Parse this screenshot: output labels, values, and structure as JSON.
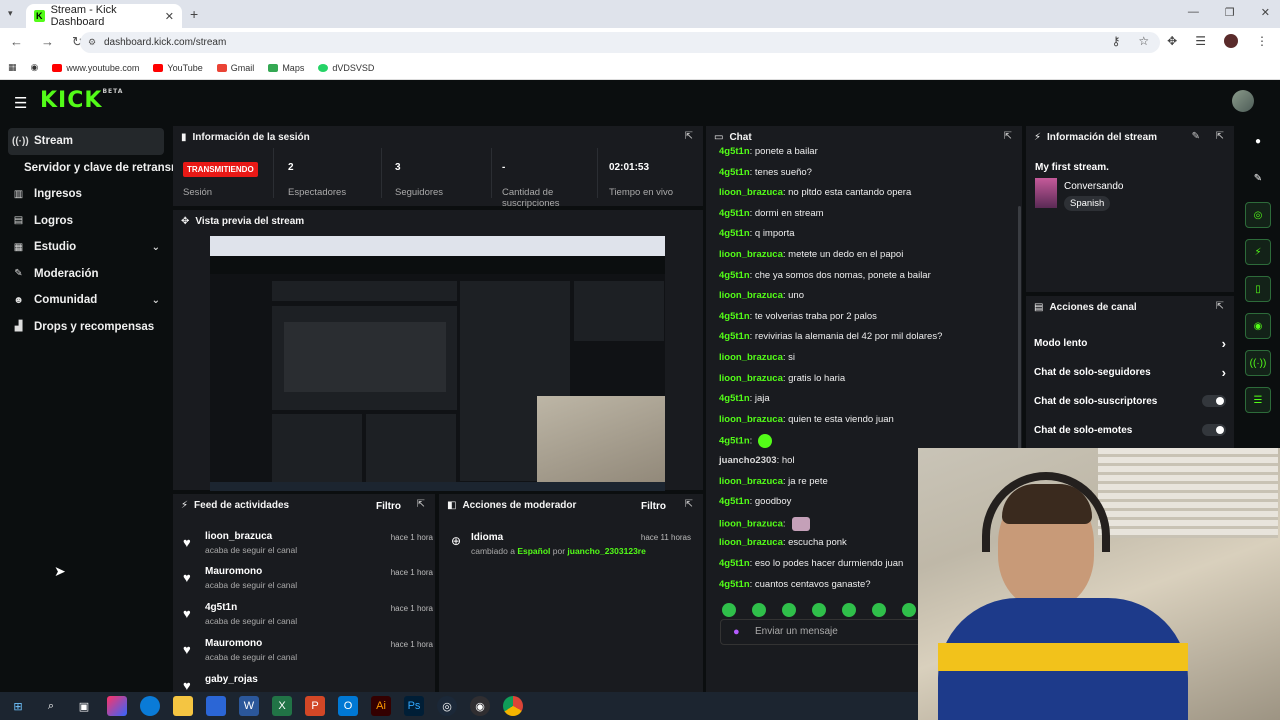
{
  "browser": {
    "tab_title": "Stream - Kick Dashboard",
    "tab_close": "✕",
    "new_tab": "+",
    "url": "dashboard.kick.com/stream",
    "bookmarks": [
      {
        "label": "www.youtube.com",
        "color": "#ff0000"
      },
      {
        "label": "YouTube",
        "color": "#ff0000"
      },
      {
        "label": "Gmail",
        "color": "#ea4335"
      },
      {
        "label": "Maps",
        "color": "#34a853"
      },
      {
        "label": "dVDSVSD",
        "color": "#25d366"
      }
    ]
  },
  "app": {
    "logo": "KICK",
    "logo_sup": "BETA",
    "accent": "#53fc18"
  },
  "sidebar": {
    "items": [
      {
        "label": "Stream",
        "icon": "broadcast-icon",
        "glyph": "((·))",
        "active": true
      },
      {
        "label": "Servidor y clave de retransm",
        "sub": true
      },
      {
        "label": "Ingresos",
        "icon": "chart-icon",
        "glyph": "▥"
      },
      {
        "label": "Logros",
        "icon": "book-icon",
        "glyph": "▤"
      },
      {
        "label": "Estudio",
        "icon": "studio-icon",
        "glyph": "▦",
        "chevron": true
      },
      {
        "label": "Moderación",
        "icon": "wrench-icon",
        "glyph": "✎"
      },
      {
        "label": "Comunidad",
        "icon": "people-icon",
        "glyph": "☻",
        "chevron": true
      },
      {
        "label": "Drops y recompensas",
        "icon": "drops-icon",
        "glyph": "▟"
      }
    ]
  },
  "session": {
    "title": "Información de la sesión",
    "live_badge": "TRANSMITIENDO",
    "live_label": "Sesión",
    "viewers_value": "2",
    "viewers_label": "Espectadores",
    "followers_value": "3",
    "followers_label": "Seguidores",
    "subs_value": "-",
    "subs_label": "Cantidad de suscripciones",
    "uptime_value": "02:01:53",
    "uptime_label": "Tiempo en vivo"
  },
  "preview": {
    "title": "Vista previa del stream"
  },
  "activity_feed": {
    "title": "Feed de actividades",
    "filter": "Filtro",
    "items": [
      {
        "name": "lioon_brazuca",
        "sub": "acaba de seguir el canal",
        "time": "hace 1 hora"
      },
      {
        "name": "Mauromono",
        "sub": "acaba de seguir el canal",
        "time": "hace 1 hora"
      },
      {
        "name": "4g5t1n",
        "sub": "acaba de seguir el canal",
        "time": "hace 1 hora"
      },
      {
        "name": "Mauromono",
        "sub": "acaba de seguir el canal",
        "time": "hace 1 hora"
      },
      {
        "name": "gaby_rojas",
        "sub": "",
        "time": ""
      }
    ]
  },
  "mod_actions": {
    "title": "Acciones de moderador",
    "filter": "Filtro",
    "item_title": "Idioma",
    "item_time": "hace 11 horas",
    "item_pre": "cambiado a ",
    "item_lang": "Español",
    "item_por": " por ",
    "item_user": "juancho_2303123re"
  },
  "chat": {
    "title": "Chat",
    "input_placeholder": "Enviar un mensaje",
    "messages": [
      {
        "user": "4g5t1n",
        "text": ": ponete a bailar"
      },
      {
        "user": "4g5t1n",
        "text": ": tenes sueño?"
      },
      {
        "user": "lioon_brazuca",
        "text": ": no pltdo esta cantando opera"
      },
      {
        "user": "4g5t1n",
        "text": ": dormi en stream"
      },
      {
        "user": "4g5t1n",
        "text": ": q importa"
      },
      {
        "user": "lioon_brazuca",
        "text": ": metete un dedo en el papoi"
      },
      {
        "user": "4g5t1n",
        "text": ": che ya somos dos nomas, ponete a bailar"
      },
      {
        "user": "lioon_brazuca",
        "text": ": uno"
      },
      {
        "user": "4g5t1n",
        "text": ": te volverias traba por 2 palos"
      },
      {
        "user": "4g5t1n",
        "text": ": revivirias la alemania del 42 por mil dolares?"
      },
      {
        "user": "lioon_brazuca",
        "text": ": si"
      },
      {
        "user": "lioon_brazuca",
        "text": ": gratis lo haria"
      },
      {
        "user": "4g5t1n",
        "text": ": jaja"
      },
      {
        "user": "lioon_brazuca",
        "text": ": quien te esta viendo juan"
      },
      {
        "user": "4g5t1n",
        "text": ":",
        "emote": true
      },
      {
        "user": "juancho2303",
        "text": ": hol",
        "owner": true
      },
      {
        "user": "lioon_brazuca",
        "text": ": ja re pete"
      },
      {
        "user": "4g5t1n",
        "text": ": goodboy"
      },
      {
        "user": "lioon_brazuca",
        "text": ":",
        "emote2": true
      },
      {
        "user": "lioon_brazuca",
        "text": ": escucha ponk"
      },
      {
        "user": "4g5t1n",
        "text": ": eso lo podes hacer durmiendo juan"
      },
      {
        "user": "4g5t1n",
        "text": ": cuantos centavos ganaste?"
      }
    ]
  },
  "stream_info": {
    "title": "Información del stream",
    "stream_title": "My first stream.",
    "category": "Conversando",
    "language": "Spanish"
  },
  "channel_actions": {
    "title": "Acciones de canal",
    "rows": [
      {
        "label": "Modo lento",
        "type": "arrow"
      },
      {
        "label": "Chat de solo-seguidores",
        "type": "arrow"
      },
      {
        "label": "Chat de solo-suscriptores",
        "type": "toggle"
      },
      {
        "label": "Chat de solo-emotes",
        "type": "toggle"
      }
    ]
  },
  "taskbar": {
    "apps": [
      "windows-icon",
      "search-icon",
      "taskview-icon",
      "copilot-icon",
      "edge-icon",
      "explorer-icon",
      "store-icon",
      "word-icon",
      "excel-icon",
      "powerpoint-icon",
      "outlook-icon",
      "illustrator-icon",
      "photoshop-icon",
      "steam-icon",
      "obs-icon",
      "chrome-icon"
    ]
  }
}
